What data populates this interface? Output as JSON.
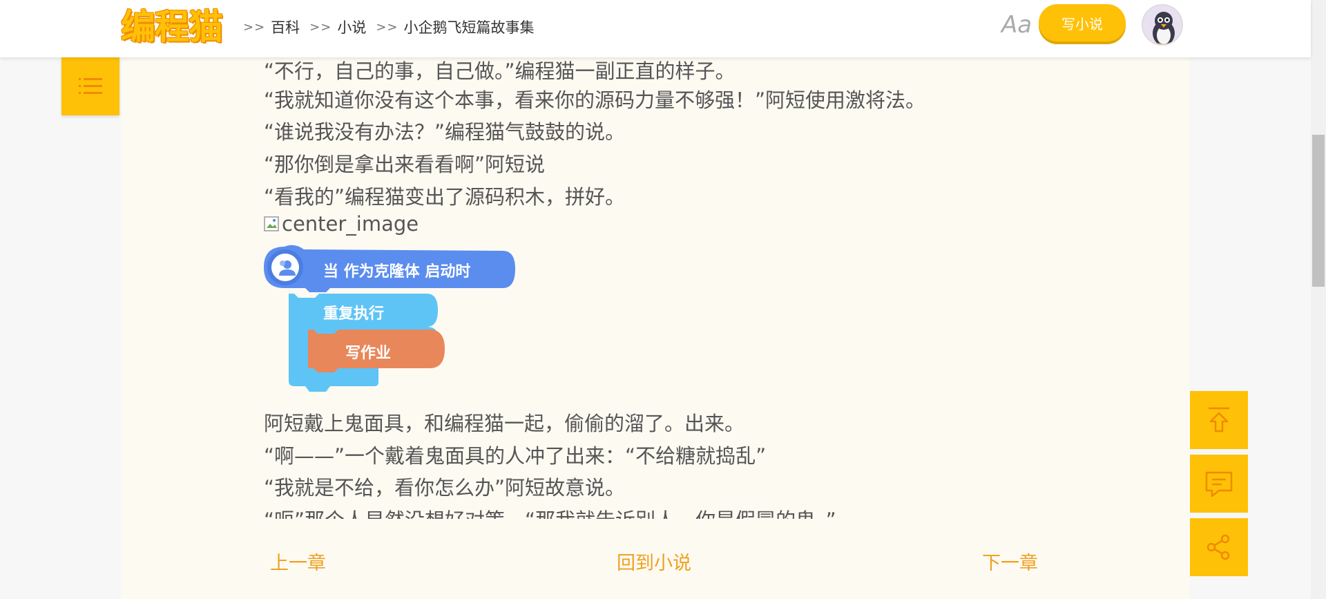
{
  "header": {
    "logo_text": "编程猫",
    "breadcrumb": [
      {
        "sep": ">>",
        "label": "百科"
      },
      {
        "sep": ">>",
        "label": "小说"
      },
      {
        "sep": ">>",
        "label": "小企鹅飞短篇故事集"
      }
    ],
    "font_toggle": "Aa",
    "write_button": "写小说",
    "avatar_icon": "penguin-avatar-icon"
  },
  "article": {
    "paragraphs_top": [
      "“不行，自己的事，自己做。”编程猫一副正直的样子。",
      "“我就知道你没有这个本事，看来你的源码力量不够强！”阿短使用激将法。",
      "“谁说我没有办法？”编程猫气鼓鼓的说。",
      "“那你倒是拿出来看看啊”阿短说",
      "“看我的”编程猫变出了源码积木，拼好。"
    ],
    "broken_image_alt": "center_image",
    "code_blocks": {
      "hat_block": "当 作为克隆体 启动时",
      "loop_block": "重复执行",
      "action_block": "写作业",
      "colors": {
        "hat": "#5b8def",
        "loop": "#5ec4f5",
        "action": "#e8875a"
      }
    },
    "paragraphs_bottom": [
      "阿短戴上鬼面具，和编程猫一起，偷偷的溜了。出来。",
      "“啊——”一个戴着鬼面具的人冲了出来：“不给糖就捣乱”",
      "“我就是不给，看你怎么办”阿短故意说。",
      "“呃”那个人显然没想好对策，“那我就告诉别人，你是假冒的鬼。”"
    ]
  },
  "chapter_nav": {
    "prev": "上一章",
    "back": "回到小说",
    "next": "下一章"
  },
  "float_buttons": [
    "back-to-top-icon",
    "comment-icon",
    "share-icon"
  ],
  "menu_icon": "list-menu-icon",
  "colors": {
    "accent": "#ffc107",
    "link": "#f0a020",
    "content_bg": "#fdfaf2"
  }
}
